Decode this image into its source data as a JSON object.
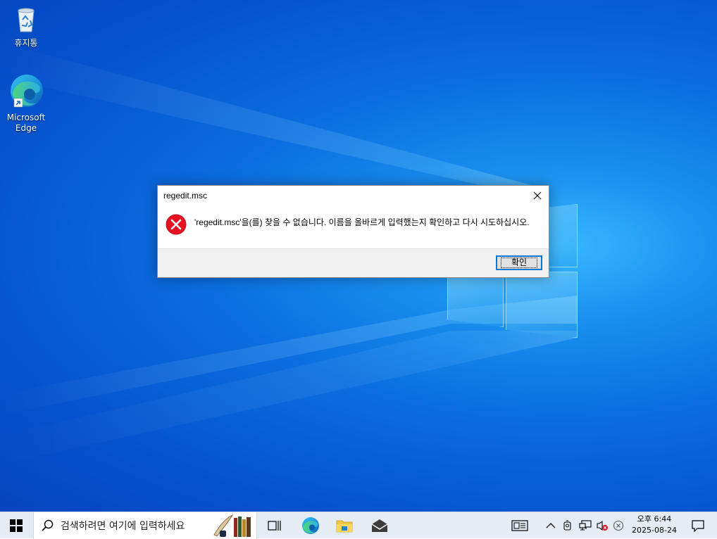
{
  "desktop": {
    "icons": [
      {
        "name": "recycle-bin",
        "label": "휴지통"
      },
      {
        "name": "microsoft-edge",
        "label_line1": "Microsoft",
        "label_line2": "Edge"
      }
    ]
  },
  "dialog": {
    "title": "regedit.msc",
    "message": "'regedit.msc'을(를) 찾을 수 없습니다. 이름을 올바르게 입력했는지 확인하고 다시 시도하십시오.",
    "ok_label": "확인",
    "icon": "error-icon"
  },
  "taskbar": {
    "search_placeholder": "검색하려면 여기에 입력하세요",
    "pinned": [
      "task-view-icon",
      "edge-icon",
      "file-explorer-icon",
      "mail-icon"
    ],
    "tray_icons": [
      "news-icon",
      "chevron-up-icon",
      "meet-icon",
      "network-icon",
      "volume-muted-icon",
      "defender-warning-icon"
    ],
    "clock": {
      "time": "오후 6:44",
      "date": "2025-08-24"
    }
  },
  "colors": {
    "accent": "#0078d7",
    "error": "#e81123",
    "taskbar": "#e5ecf3"
  }
}
